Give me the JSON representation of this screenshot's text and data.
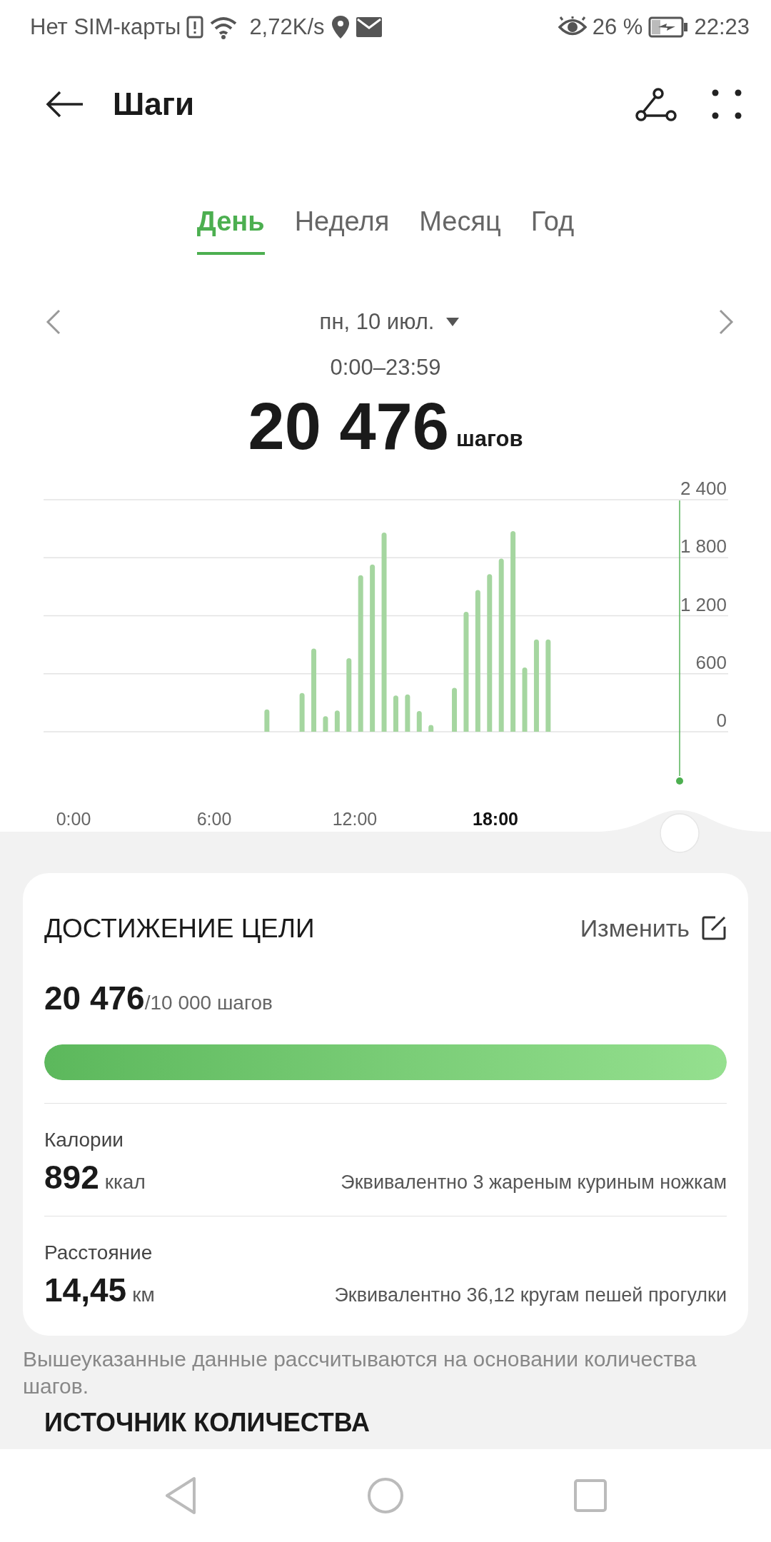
{
  "status_bar": {
    "carrier": "Нет SIM-карты",
    "speed": "2,72K/s",
    "battery": "26 %",
    "time": "22:23"
  },
  "header": {
    "title": "Шаги"
  },
  "tabs": [
    {
      "label": "День",
      "selected": true
    },
    {
      "label": "Неделя",
      "selected": false
    },
    {
      "label": "Месяц",
      "selected": false
    },
    {
      "label": "Год",
      "selected": false
    }
  ],
  "date_nav": {
    "date": "пн, 10 июл.",
    "range": "0:00–23:59"
  },
  "total": {
    "value": "20 476",
    "unit": "шагов"
  },
  "chart": {
    "chart_data": {
      "type": "bar",
      "x": [
        8.25,
        9.75,
        10.25,
        10.75,
        11.25,
        11.75,
        12.25,
        12.75,
        13.25,
        13.75,
        14.25,
        14.75,
        15.25,
        16.25,
        16.75,
        17.25,
        17.75,
        18.25,
        18.75,
        19.25,
        19.75,
        20.25
      ],
      "series": [
        {
          "color": "#a5d6a0",
          "values": [
            230,
            400,
            860,
            160,
            220,
            760,
            1620,
            1730,
            2060,
            375,
            385,
            215,
            70,
            455,
            1240,
            1465,
            1630,
            1790,
            2075,
            665,
            955,
            955
          ]
        }
      ],
      "grid": true,
      "xticks": [
        {
          "value": 0,
          "label": "0:00"
        },
        {
          "value": 6,
          "label": "6:00"
        },
        {
          "value": 12,
          "label": "12:00"
        },
        {
          "value": 18,
          "label": "18:00"
        }
      ],
      "yticks": [
        {
          "value": 0,
          "label": "0"
        },
        {
          "value": 600,
          "label": "600"
        },
        {
          "value": 1200,
          "label": "1 200"
        },
        {
          "value": 1800,
          "label": "1 800"
        },
        {
          "value": 2400,
          "label": "2 400"
        }
      ],
      "xlim": [
        -1.28,
        27.93
      ],
      "ylim": [
        0,
        2400
      ]
    },
    "tick_states": [
      {
        "selected": false
      },
      {
        "selected": false
      },
      {
        "selected": false
      },
      {
        "selected": true
      }
    ]
  },
  "goal": {
    "title": "ДОСТИЖЕНИЕ ЦЕЛИ",
    "edit": "Изменить",
    "value": "20 476",
    "target": "/10 000 шагов",
    "level": 1
  },
  "stats": [
    {
      "label": "Калории",
      "value": "892",
      "unit": "ккал",
      "note": "Эквивалентно 3 жареным куриным ножкам"
    },
    {
      "label": "Расстояние",
      "value": "14,45",
      "unit": "км",
      "note": "Эквивалентно 36,12 кругам пешей прогулки"
    }
  ],
  "footnote": "Вышеуказанные данные рассчитываются на основании количества шагов.",
  "next_section": "ИСТОЧНИК КОЛИЧЕСТВА"
}
